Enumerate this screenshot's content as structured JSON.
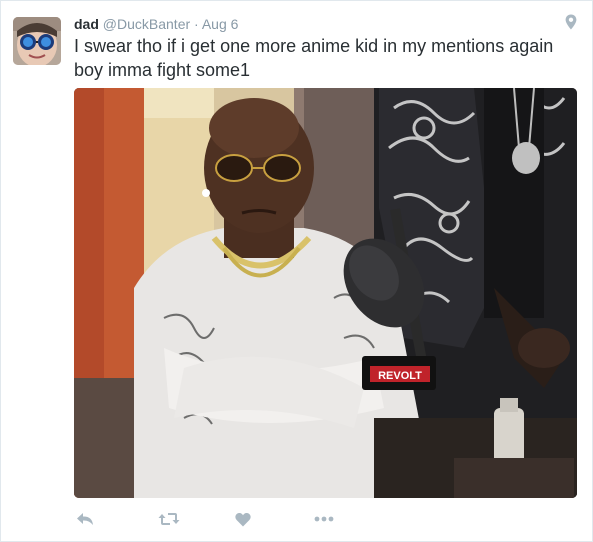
{
  "tweet": {
    "display_name": "dad",
    "handle": "@DuckBanter",
    "separator": "·",
    "date": "Aug 6",
    "text": "I swear tho if i get one more anime kid in my mentions again boy imma fight some1"
  },
  "icons": {
    "location": "location-pin-icon",
    "reply": "reply-icon",
    "retweet": "retweet-icon",
    "like": "heart-icon",
    "more": "more-icon"
  },
  "media": {
    "mic_flag_text": "REVOLT"
  },
  "colors": {
    "name": "#292f33",
    "meta": "#8899a6",
    "action_icon": "#aab8c2",
    "revolt_red": "#c0232a"
  }
}
